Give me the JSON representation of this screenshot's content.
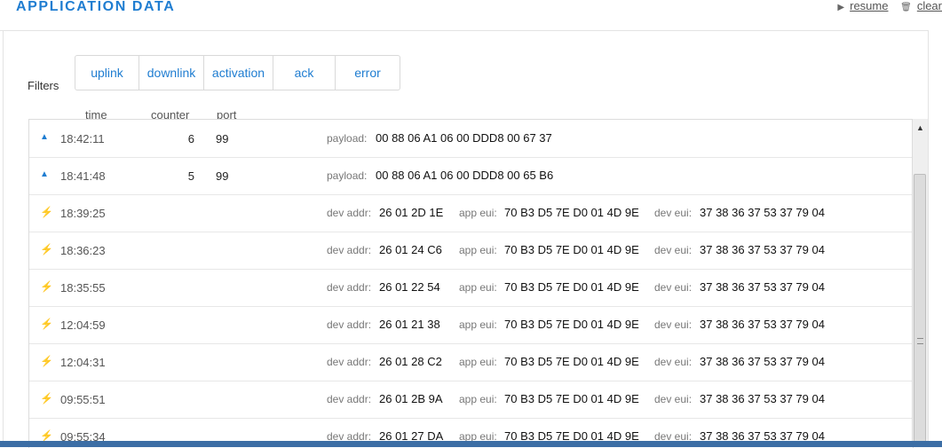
{
  "header": {
    "title": "APPLICATION DATA",
    "resume_label": "resume",
    "clear_label": "clear"
  },
  "filters": {
    "label": "Filters",
    "items": [
      {
        "label": "uplink"
      },
      {
        "label": "downlink"
      },
      {
        "label": "activation"
      },
      {
        "label": "ack"
      },
      {
        "label": "error"
      }
    ]
  },
  "columns": {
    "time": "time",
    "counter": "counter",
    "port": "port"
  },
  "rows": [
    {
      "type": "uplink",
      "icon": "triangle-up-icon",
      "time": "18:42:11",
      "counter": "6",
      "port": "99",
      "payload_key": "payload:",
      "payload": "00 88 06 A1 06 00 DDD8 00 67 37"
    },
    {
      "type": "uplink",
      "icon": "triangle-up-icon",
      "time": "18:41:48",
      "counter": "5",
      "port": "99",
      "payload_key": "payload:",
      "payload": "00 88 06 A1 06 00 DDD8 00 65 B6"
    },
    {
      "type": "activation",
      "icon": "lightning-bolt-icon",
      "time": "18:39:25",
      "dev_addr_key": "dev addr:",
      "dev_addr": "26 01 2D 1E",
      "app_eui_key": "app eui:",
      "app_eui": "70 B3 D5 7E D0 01 4D 9E",
      "dev_eui_key": "dev eui:",
      "dev_eui": "37 38 36 37 53 37 79 04"
    },
    {
      "type": "activation",
      "icon": "lightning-bolt-icon",
      "time": "18:36:23",
      "dev_addr_key": "dev addr:",
      "dev_addr": "26 01 24 C6",
      "app_eui_key": "app eui:",
      "app_eui": "70 B3 D5 7E D0 01 4D 9E",
      "dev_eui_key": "dev eui:",
      "dev_eui": "37 38 36 37 53 37 79 04"
    },
    {
      "type": "activation",
      "icon": "lightning-bolt-icon",
      "time": "18:35:55",
      "dev_addr_key": "dev addr:",
      "dev_addr": "26 01 22 54",
      "app_eui_key": "app eui:",
      "app_eui": "70 B3 D5 7E D0 01 4D 9E",
      "dev_eui_key": "dev eui:",
      "dev_eui": "37 38 36 37 53 37 79 04"
    },
    {
      "type": "activation",
      "icon": "lightning-bolt-icon",
      "time": "12:04:59",
      "dev_addr_key": "dev addr:",
      "dev_addr": "26 01 21 38",
      "app_eui_key": "app eui:",
      "app_eui": "70 B3 D5 7E D0 01 4D 9E",
      "dev_eui_key": "dev eui:",
      "dev_eui": "37 38 36 37 53 37 79 04"
    },
    {
      "type": "activation",
      "icon": "lightning-bolt-icon",
      "time": "12:04:31",
      "dev_addr_key": "dev addr:",
      "dev_addr": "26 01 28 C2",
      "app_eui_key": "app eui:",
      "app_eui": "70 B3 D5 7E D0 01 4D 9E",
      "dev_eui_key": "dev eui:",
      "dev_eui": "37 38 36 37 53 37 79 04"
    },
    {
      "type": "activation",
      "icon": "lightning-bolt-icon",
      "time": "09:55:51",
      "dev_addr_key": "dev addr:",
      "dev_addr": "26 01 2B 9A",
      "app_eui_key": "app eui:",
      "app_eui": "70 B3 D5 7E D0 01 4D 9E",
      "dev_eui_key": "dev eui:",
      "dev_eui": "37 38 36 37 53 37 79 04"
    },
    {
      "type": "activation",
      "icon": "lightning-bolt-icon",
      "time": "09:55:34",
      "dev_addr_key": "dev addr:",
      "dev_addr": "26 01 27 DA",
      "app_eui_key": "app eui:",
      "app_eui": "70 B3 D5 7E D0 01 4D 9E",
      "dev_eui_key": "dev eui:",
      "dev_eui": "37 38 36 37 53 37 79 04"
    }
  ],
  "colors": {
    "accent": "#1f7dd1",
    "activation_icon": "#f2b733"
  }
}
